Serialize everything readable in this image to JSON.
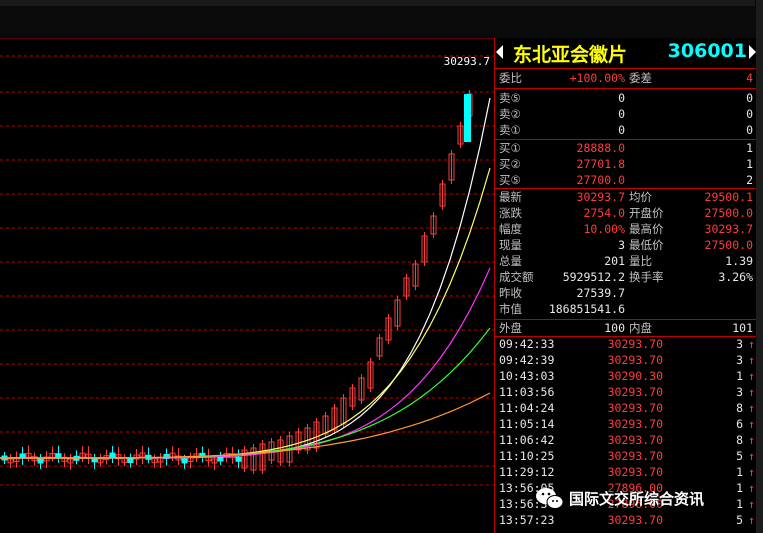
{
  "stock": {
    "name": "东北亚会徽片",
    "code": "306001"
  },
  "chart_label": "30293.7",
  "order_ratio": {
    "label1": "委比",
    "value1": "+100.00%",
    "label2": "委差",
    "value2": "4"
  },
  "asks": [
    {
      "label": "卖⑤",
      "price": "0",
      "vol": "0"
    },
    {
      "label": "卖②",
      "price": "0",
      "vol": "0"
    },
    {
      "label": "卖①",
      "price": "0",
      "vol": "0"
    }
  ],
  "bids": [
    {
      "label": "买①",
      "price": "28888.0",
      "vol": "1"
    },
    {
      "label": "买②",
      "price": "27701.8",
      "vol": "1"
    },
    {
      "label": "买⑤",
      "price": "27700.0",
      "vol": "2"
    }
  ],
  "quote": [
    {
      "l1": "最新",
      "v1": "30293.7",
      "l2": "均价",
      "v2": "29500.1"
    },
    {
      "l1": "涨跌",
      "v1": "2754.0",
      "l2": "开盘价",
      "v2": "27500.0"
    },
    {
      "l1": "幅度",
      "v1": "10.00%",
      "l2": "最高价",
      "v2": "30293.7"
    },
    {
      "l1": "现量",
      "v1": "3",
      "l2": "最低价",
      "v2": "27500.0"
    },
    {
      "l1": "总量",
      "v1": "201",
      "l2": "量比",
      "v2": "1.39"
    },
    {
      "l1": "成交额",
      "v1": "5929512.2",
      "l2": "换手率",
      "v2": "3.26%"
    }
  ],
  "prev_close": {
    "label": "昨收",
    "value": "27539.7"
  },
  "market_value": {
    "label": "市值",
    "value": "186851541.6"
  },
  "outer_inner": {
    "l1": "外盘",
    "v1": "100",
    "l2": "内盘",
    "v2": "101"
  },
  "ticks": [
    {
      "time": "09:42:33",
      "price": "30293.70",
      "vol": "3"
    },
    {
      "time": "09:42:39",
      "price": "30293.70",
      "vol": "3"
    },
    {
      "time": "10:43:03",
      "price": "30290.30",
      "vol": "1"
    },
    {
      "time": "11:03:56",
      "price": "30293.70",
      "vol": "3"
    },
    {
      "time": "11:04:24",
      "price": "30293.70",
      "vol": "8"
    },
    {
      "time": "11:05:14",
      "price": "30293.70",
      "vol": "6"
    },
    {
      "time": "11:06:42",
      "price": "30293.70",
      "vol": "8"
    },
    {
      "time": "11:10:25",
      "price": "30293.70",
      "vol": "5"
    },
    {
      "time": "11:29:12",
      "price": "30293.70",
      "vol": "1"
    },
    {
      "time": "13:56:05",
      "price": "27896.00",
      "vol": "1"
    },
    {
      "time": "13:56:30",
      "price": "27896.00",
      "vol": "1"
    },
    {
      "time": "13:57:23",
      "price": "30293.70",
      "vol": "5"
    }
  ],
  "tick_arrow": "↑",
  "watermark": "国际文交所综合资讯",
  "colors": {
    "up": "#ff3c3c",
    "down": "#00ffff",
    "grid": "#c00000",
    "ma1": "#ffffff",
    "ma2": "#ffff66",
    "ma3": "#ff33ff",
    "ma4": "#33ff33",
    "ma5": "#ff9933"
  }
}
